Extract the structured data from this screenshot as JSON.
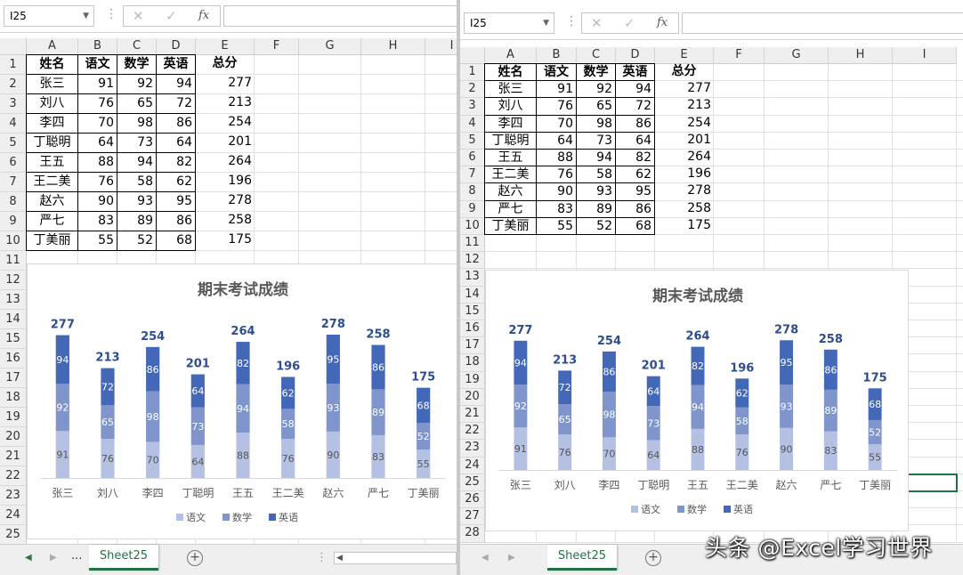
{
  "name_box": "I25",
  "formula_icons": {
    "cancel": "✕",
    "enter": "✓",
    "fx": "fx"
  },
  "columns": [
    "A",
    "B",
    "C",
    "D",
    "E",
    "F",
    "G",
    "H",
    "I"
  ],
  "table": {
    "headers": [
      "姓名",
      "语文",
      "数学",
      "英语",
      "总分"
    ],
    "rows": [
      [
        "张三",
        "91",
        "92",
        "94",
        "277"
      ],
      [
        "刘八",
        "76",
        "65",
        "72",
        "213"
      ],
      [
        "李四",
        "70",
        "98",
        "86",
        "254"
      ],
      [
        "丁聪明",
        "64",
        "73",
        "64",
        "201"
      ],
      [
        "王五",
        "88",
        "94",
        "82",
        "264"
      ],
      [
        "王二美",
        "76",
        "58",
        "62",
        "196"
      ],
      [
        "赵六",
        "90",
        "93",
        "95",
        "278"
      ],
      [
        "严七",
        "83",
        "89",
        "86",
        "258"
      ],
      [
        "丁美丽",
        "55",
        "52",
        "68",
        "175"
      ]
    ]
  },
  "sheet_tab": "Sheet25",
  "nav": {
    "ellipsis": "..."
  },
  "watermark": "头条 @Excel学习世界",
  "colors": {
    "s1": "#b4c1e2",
    "s2": "#7f95cc",
    "s3": "#4368b8",
    "total_label": "#2e4d8e",
    "accent": "#217346"
  },
  "chart_data": {
    "type": "bar",
    "stacked": true,
    "title": "期末考试成绩",
    "categories": [
      "张三",
      "刘八",
      "李四",
      "丁聪明",
      "王五",
      "王二美",
      "赵六",
      "严七",
      "丁美丽"
    ],
    "series": [
      {
        "name": "语文",
        "values": [
          91,
          76,
          70,
          64,
          88,
          76,
          90,
          83,
          55
        ]
      },
      {
        "name": "数学",
        "values": [
          92,
          65,
          98,
          73,
          94,
          58,
          93,
          89,
          52
        ]
      },
      {
        "name": "英语",
        "values": [
          94,
          72,
          86,
          64,
          82,
          62,
          95,
          86,
          68
        ]
      }
    ],
    "totals": [
      277,
      213,
      254,
      201,
      264,
      196,
      278,
      258,
      175
    ],
    "legend_position": "bottom",
    "grid": false,
    "ylim": [
      0,
      290
    ]
  }
}
